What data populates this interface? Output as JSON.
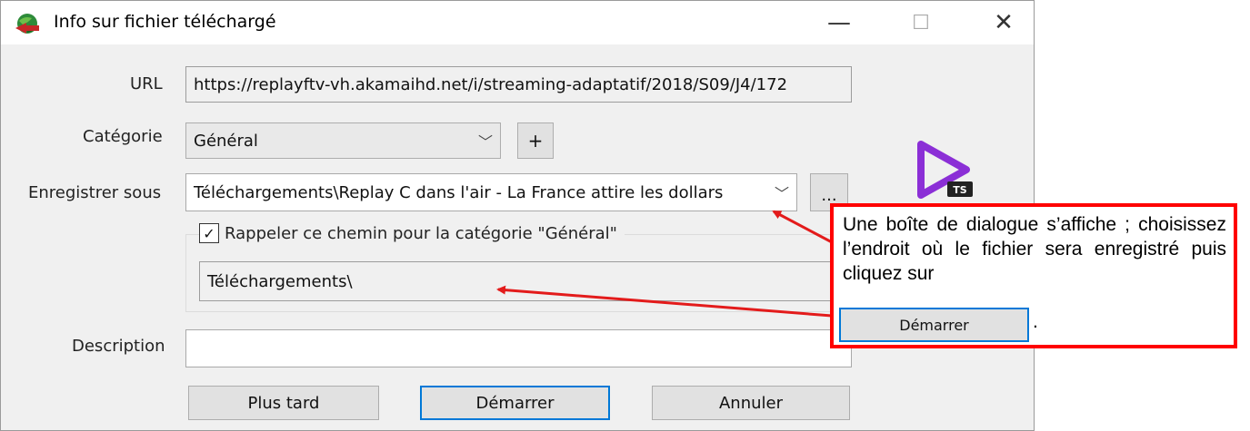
{
  "window": {
    "title": "Info sur fichier téléchargé",
    "minimize_glyph": "—",
    "maximize_glyph": "☐",
    "close_glyph": "✕"
  },
  "form": {
    "url_label": "URL",
    "url_value": "https://replayftv-vh.akamaihd.net/i/streaming-adaptatif/2018/S09/J4/172",
    "category_label": "Catégorie",
    "category_value": "Général",
    "add_category_label": "+",
    "save_as_label": "Enregistrer sous",
    "save_as_value": "Téléchargements\\Replay C dans l'air - La France attire les dollars",
    "browse_label": "...",
    "remember_path_label": "Rappeler ce chemin pour la catégorie \"Général\"",
    "remember_path_checked": true,
    "remembered_path_value": "Téléchargements\\",
    "description_label": "Description",
    "description_value": ""
  },
  "buttons": {
    "later": "Plus tard",
    "start": "Démarrer",
    "cancel": "Annuler"
  },
  "logo": {
    "badge": "TS",
    "color": "#8b2fd6"
  },
  "callout": {
    "text": "Une boîte de dialogue s’affiche ; choisissez l’endroit où le fichier sera enregistré puis cliquez sur",
    "button_label": "Démarrer",
    "trailing": ".",
    "border_color": "#ff0000",
    "arrow_color": "#e31b1b"
  },
  "icons": {
    "app": "globe-download-icon",
    "checkbox": "checkmark-icon",
    "dropdown": "chevron-down-icon"
  }
}
